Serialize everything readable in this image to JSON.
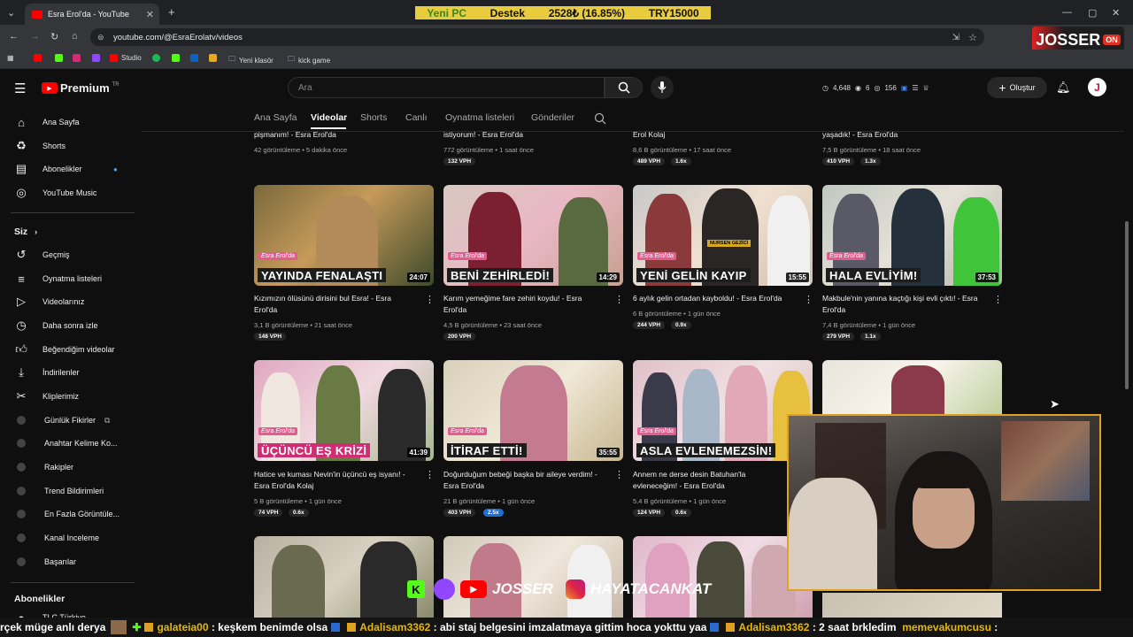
{
  "browser": {
    "tab_title": "Esra Erol'da - YouTube",
    "url": "youtube.com/@EsraErolatv/videos",
    "stock": [
      "Yeni PC",
      "Destek",
      "2528₺ (16.85%)",
      "TRY15000"
    ],
    "bookmarks": [
      "Studio",
      "Yeni klasör",
      "kick game"
    ],
    "brand_logo": "JOSSER",
    "brand_logo_suffix": "ON"
  },
  "header": {
    "premium_label": "Premium",
    "region": "TR",
    "search_placeholder": "Ara",
    "stats": [
      "4,648",
      "6",
      "156"
    ],
    "create_label": "Oluştur",
    "avatar_letter": "J"
  },
  "sidebar": {
    "main": [
      {
        "label": "Ana Sayfa",
        "icon": "home-icon"
      },
      {
        "label": "Shorts",
        "icon": "shorts-icon"
      },
      {
        "label": "Abonelikler",
        "icon": "subscriptions-icon"
      },
      {
        "label": "YouTube Music",
        "icon": "music-icon"
      }
    ],
    "you_header": "Siz",
    "you": [
      {
        "label": "Geçmiş",
        "icon": "history-icon"
      },
      {
        "label": "Oynatma listeleri",
        "icon": "playlist-icon"
      },
      {
        "label": "Videolarınız",
        "icon": "your-videos-icon"
      },
      {
        "label": "Daha sonra izle",
        "icon": "watch-later-icon"
      },
      {
        "label": "Beğendiğim videolar",
        "icon": "like-icon"
      },
      {
        "label": "İndirilenler",
        "icon": "download-icon"
      },
      {
        "label": "Kliplerimiz",
        "icon": "clip-icon"
      }
    ],
    "extensions": [
      "Günlük Fikirler",
      "Anahtar Kelime Ko...",
      "Rakipler",
      "Trend Bildirimleri",
      "En Fazla Görüntüle...",
      "Kanal Inceleme",
      "Başarılar"
    ],
    "subs_header": "Abonelikler",
    "subs_first": "TLC Türkiye"
  },
  "channel_tabs": [
    "Ana Sayfa",
    "Videolar",
    "Shorts",
    "Canlı",
    "Oynatma listeleri",
    "Gönderiler"
  ],
  "top_row": [
    {
      "title_tail": "pişmanım! - Esra Erol'da",
      "meta": "42 görüntüleme • 5 dakika önce",
      "vph": "",
      "ratio": ""
    },
    {
      "title_tail": "istiyorum! - Esra Erol'da",
      "meta": "772 görüntüleme • 1 saat önce",
      "vph": "132 VPH",
      "ratio": ""
    },
    {
      "title_tail": "Erol Kolaj",
      "meta": "8,6 B görüntüleme • 17 saat önce",
      "vph": "489 VPH",
      "ratio": "1.6x"
    },
    {
      "title_tail": "yaşadık! - Esra Erol'da",
      "meta": "7,5 B görüntüleme • 18 saat önce",
      "vph": "410 VPH",
      "ratio": "1.3x"
    }
  ],
  "row2": [
    {
      "caption": "YAYINDA FENALAŞTI",
      "duration": "24:07",
      "title": "Kızımızın ölüsünü dirisini bul Esra! - Esra Erol'da",
      "meta": "3,1 B görüntüleme • 21 saat önce",
      "vph": "148 VPH",
      "ratio": ""
    },
    {
      "caption": "BENİ ZEHİRLEDİ!",
      "duration": "14:29",
      "title": "Karım yemeğime fare zehiri koydu! - Esra Erol'da",
      "meta": "4,5 B görüntüleme • 23 saat önce",
      "vph": "200 VPH",
      "ratio": ""
    },
    {
      "caption": "YENİ GELİN KAYIP",
      "duration": "15:55",
      "title": "6 aylık gelin ortadan kayboldu! - Esra Erol'da",
      "meta": "6 B görüntüleme • 1 gün önce",
      "vph": "244 VPH",
      "ratio": "0.9x",
      "name_tag": "NURSEN GEZİCİ"
    },
    {
      "caption": "HALA EVLİYİM!",
      "duration": "37:53",
      "title": "Makbule'nin yanına kaçtığı kişi evli çıktı! - Esra Erol'da",
      "meta": "7,4 B görüntüleme • 1 gün önce",
      "vph": "279 VPH",
      "ratio": "1.1x"
    }
  ],
  "row3": [
    {
      "caption": "ÜÇÜNCÜ EŞ KRİZİ",
      "duration": "41:39",
      "title": "Hatice ve kuması Nevin'in üçüncü eş isyanı! - Esra Erol'da Kolaj",
      "meta": "5 B görüntüleme • 1 gün önce",
      "vph": "74 VPH",
      "ratio": "0.6x"
    },
    {
      "caption": "İTİRAF ETTİ!",
      "duration": "35:55",
      "title": "Doğurduğum bebeği başka bir aileye verdim! - Esra Erol'da",
      "meta": "21 B görüntüleme • 1 gün önce",
      "vph": "403 VPH",
      "ratio": "2.5x"
    },
    {
      "caption": "ASLA EVLENEMEZSİN!",
      "duration": "",
      "title": "Annem ne derse desin Batuhan'la evleneceğim! - Esra Erol'da",
      "meta": "5,4 B görüntüleme • 1 gün önce",
      "vph": "124 VPH",
      "ratio": "0.6x"
    }
  ],
  "thumb_brand": "Esra Erol'da",
  "social": {
    "name1": "JOSSER",
    "name2": "HAYATACANKAT"
  },
  "ticker": [
    {
      "user": "",
      "text": "rçek müge anlı derya"
    },
    {
      "user": "galateia00",
      "text": ": keşkem benimde olsa"
    },
    {
      "user": "Adalisam3362",
      "text": ": abi staj belgesini imzalatmaya gittim hoca yokttu yaa"
    },
    {
      "user": "Adalisam3362",
      "text": ": 2 saat brkledim"
    },
    {
      "user": "memevakumcusu",
      "text": ":"
    }
  ]
}
